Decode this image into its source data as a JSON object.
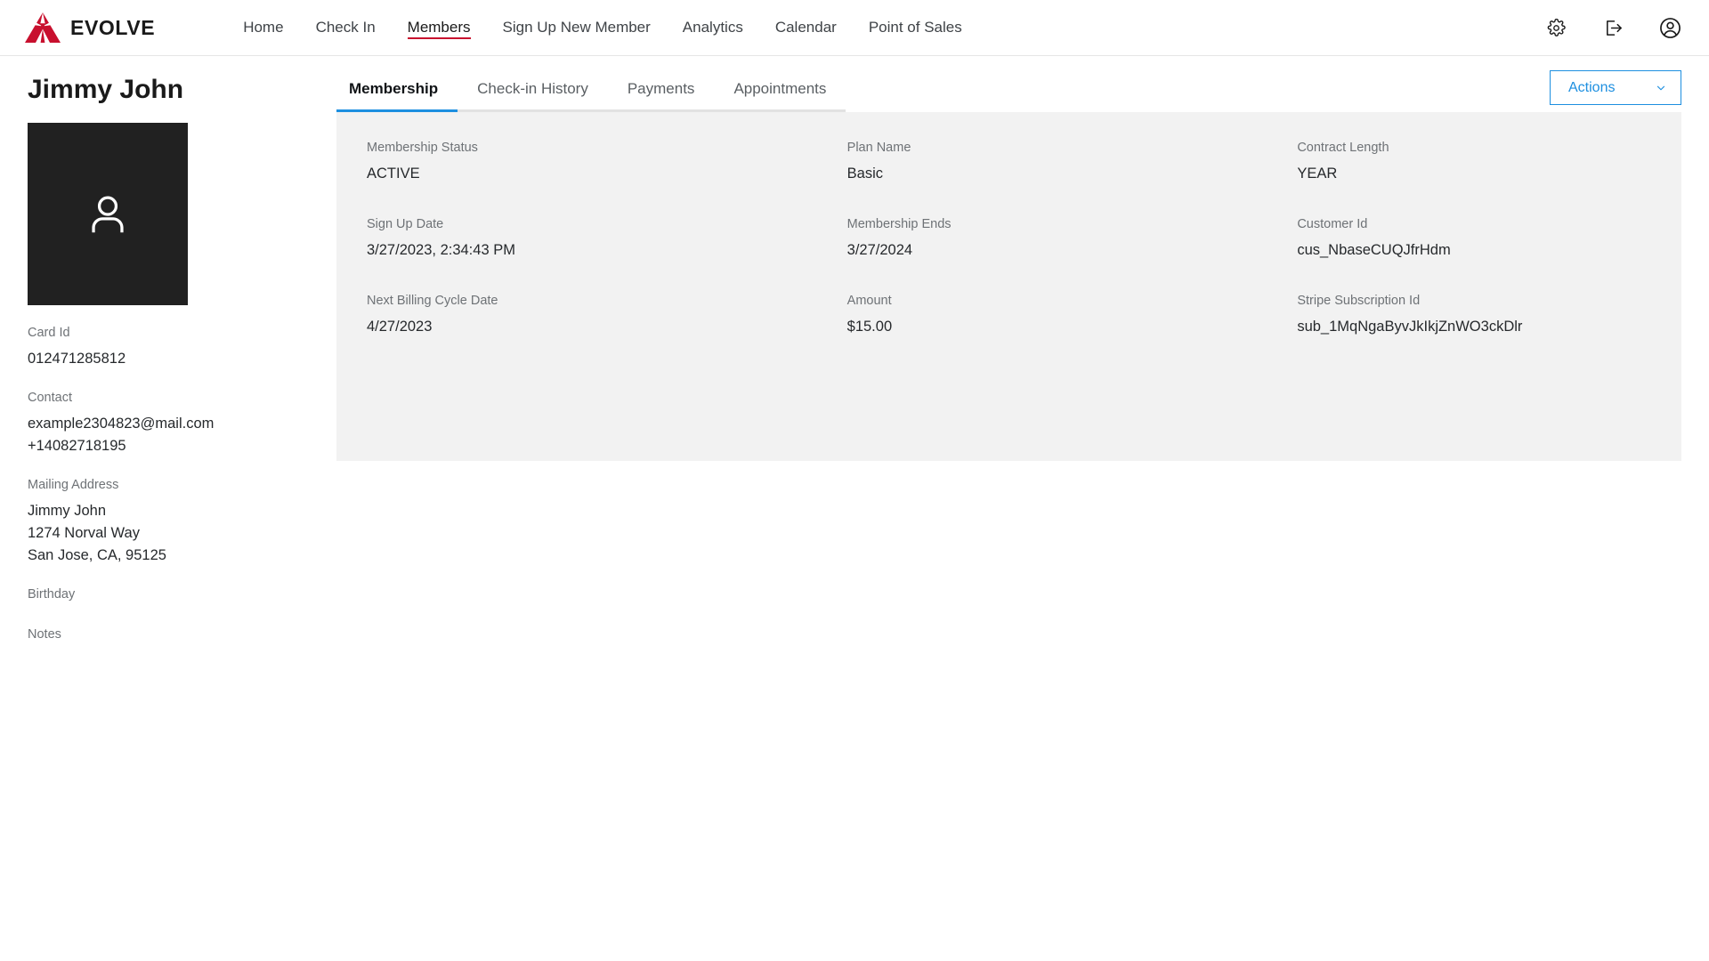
{
  "brand": {
    "name": "EVOLVE",
    "logo_icon": "evolve-triangle-logo",
    "logo_color": "#c8102e"
  },
  "topnav": {
    "items": [
      {
        "label": "Home",
        "active": false
      },
      {
        "label": "Check In",
        "active": false
      },
      {
        "label": "Members",
        "active": true
      },
      {
        "label": "Sign Up New Member",
        "active": false
      },
      {
        "label": "Analytics",
        "active": false
      },
      {
        "label": "Calendar",
        "active": false
      },
      {
        "label": "Point of Sales",
        "active": false
      }
    ],
    "active_underline_color": "#c8102e",
    "icons": [
      {
        "name": "gear-icon",
        "title": "Settings"
      },
      {
        "name": "logout-icon",
        "title": "Log out"
      },
      {
        "name": "account-circle-icon",
        "title": "Account"
      }
    ]
  },
  "member": {
    "name": "Jimmy John",
    "avatar_icon": "person-placeholder-icon",
    "avatar_bg": "#212121",
    "card_id_label": "Card Id",
    "card_id": "012471285812",
    "contact_label": "Contact",
    "email": "example2304823@mail.com",
    "phone": "+14082718195",
    "mailing_address_label": "Mailing Address",
    "address_line1": "Jimmy John",
    "address_line2": "1274 Norval Way",
    "address_line3": "San Jose, CA, 95125",
    "birthday_label": "Birthday",
    "birthday": "",
    "notes_label": "Notes",
    "notes": ""
  },
  "tabs": [
    {
      "label": "Membership",
      "active": true
    },
    {
      "label": "Check-in History",
      "active": false
    },
    {
      "label": "Payments",
      "active": false
    },
    {
      "label": "Appointments",
      "active": false
    }
  ],
  "actions": {
    "label": "Actions",
    "chevron_icon": "chevron-down-icon",
    "accent_color": "#1d8fe0"
  },
  "membership": {
    "fields": [
      {
        "label": "Membership Status",
        "value": "ACTIVE"
      },
      {
        "label": "Plan Name",
        "value": "Basic"
      },
      {
        "label": "Contract Length",
        "value": "YEAR"
      },
      {
        "label": "Sign Up Date",
        "value": "3/27/2023, 2:34:43 PM"
      },
      {
        "label": "Membership Ends",
        "value": "3/27/2024"
      },
      {
        "label": "Customer Id",
        "value": "cus_NbaseCUQJfrHdm"
      },
      {
        "label": "Next Billing Cycle Date",
        "value": "4/27/2023"
      },
      {
        "label": "Amount",
        "value": "$15.00"
      },
      {
        "label": "Stripe Subscription Id",
        "value": "sub_1MqNgaByvJkIkjZnWO3ckDlr"
      }
    ]
  }
}
